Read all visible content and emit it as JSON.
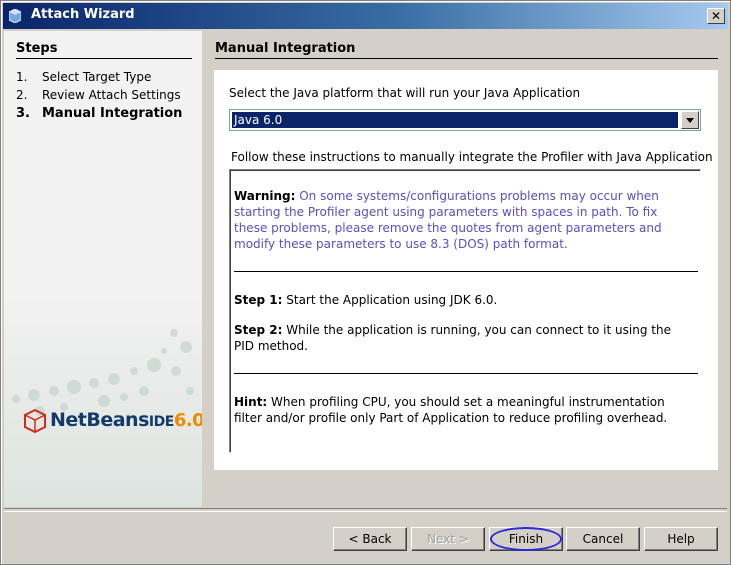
{
  "window": {
    "title": "Attach Wizard",
    "close_glyph": "✕"
  },
  "steps": {
    "title": "Steps",
    "items": [
      {
        "num": "1.",
        "label": "Select Target Type"
      },
      {
        "num": "2.",
        "label": "Review Attach Settings"
      },
      {
        "num": "3.",
        "label": "Manual Integration"
      }
    ],
    "current_index": 2
  },
  "logo": {
    "text": "NetBeans",
    "ide": "IDE",
    "version": "6.0"
  },
  "page": {
    "title": "Manual Integration",
    "select_label": "Select the Java platform that will run your Java Application",
    "platform_value": "Java 6.0",
    "instructions_label": "Follow these instructions to manually integrate the Profiler with Java Application"
  },
  "instructions": {
    "warning_label": "Warning:",
    "warning_text": " On some systems/configurations problems may occur when starting the Profiler agent using parameters with spaces in path. To fix these problems, please remove the quotes from agent parameters and modify these parameters to use 8.3 (DOS) path format.",
    "step1_label": "Step 1:",
    "step1_text": " Start the Application using JDK 6.0.",
    "step2_label": "Step 2:",
    "step2_text": " While the application is running, you can connect to it using the PID method.",
    "hint_label": "Hint:",
    "hint_text": " When profiling CPU, you should set a meaningful instrumentation filter and/or profile only Part of Application to reduce profiling overhead."
  },
  "buttons": {
    "back": "< Back",
    "next": "Next >",
    "finish": "Finish",
    "cancel": "Cancel",
    "help": "Help"
  },
  "colors": {
    "warning_text": "#5b4fc0",
    "selection": "#0a246a",
    "annotation_circle": "#2a2adb"
  }
}
